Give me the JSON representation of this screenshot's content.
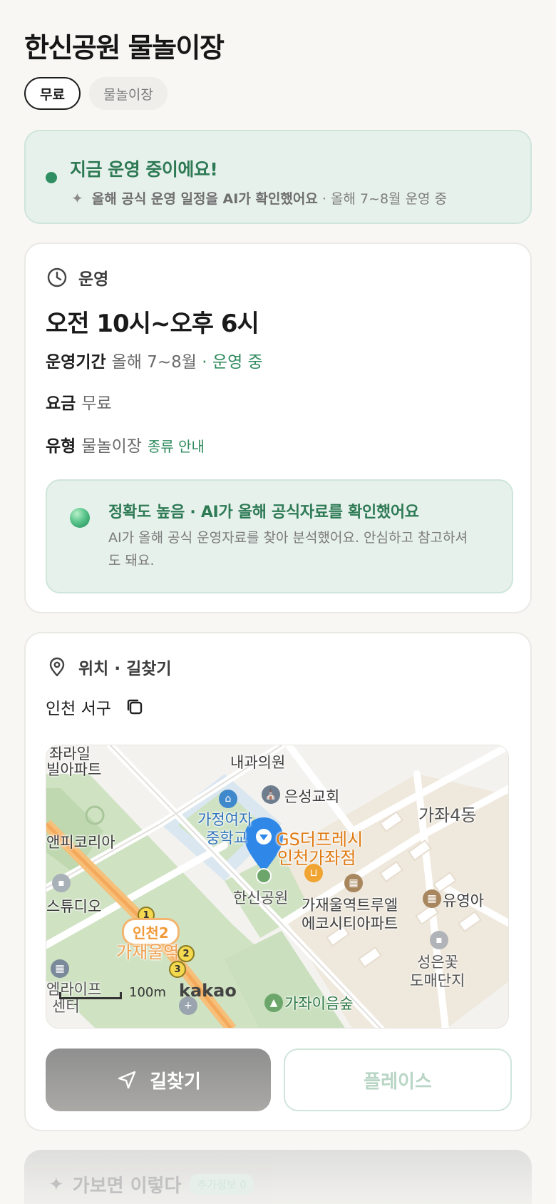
{
  "title": "한신공원 물놀이장",
  "chips": [
    "무료",
    "물놀이장"
  ],
  "status": {
    "title": "지금 운영 중이에요!",
    "sub_bold": "올해 공식 운영 일정을 AI가 확인했어요",
    "sub_rest": "· 올해 7~8월 운영 중"
  },
  "operation": {
    "heading": "운영",
    "hours": "오전 10시~오후 6시",
    "period_key": "운영기간",
    "period_val": "올해 7~8월",
    "period_status": "· 운영 중",
    "fee_key": "요금",
    "fee_val": "무료",
    "type_key": "유형",
    "type_val": "물놀이장",
    "type_link": "종류 안내",
    "ai_title": "정확도 높음 · AI가 올해 공식자료를 확인했어요",
    "ai_desc": "AI가 올해 공식 운영자료를 찾아 분석했어요. 안심하고 참고하셔도 돼요."
  },
  "location": {
    "heading": "위치 · 길찾기",
    "address": "인천 서구",
    "map": {
      "labels": {
        "l1": "좌라일",
        "l2": "빌아파트",
        "l3": "내과의원",
        "l4": "은성교회",
        "l5": "가정여자",
        "l6": "중학교",
        "l7": "GS더프레시",
        "l8": "인천가좌점",
        "l9": "가좌4동",
        "l10": "앤피코리아",
        "l11": "한신공원",
        "l12": "가재울역트루엘",
        "l13": "에코시티아파트",
        "l14": "유영아",
        "l15": "스튜디오",
        "l16": "인천2",
        "l17": "가재울역",
        "l18": "성은꽃",
        "l19": "도매단지",
        "l20": "엠라이프",
        "l21": "센터",
        "l22": "가좌이음숲"
      },
      "line_numbers": [
        "1",
        "2",
        "3"
      ],
      "scale": "100m",
      "brand": "kakao"
    },
    "directions_label": "길찾기",
    "place_label": "플레이스"
  },
  "next_section": {
    "title": "가보면 이렇다",
    "badge": "추가정보 0"
  }
}
